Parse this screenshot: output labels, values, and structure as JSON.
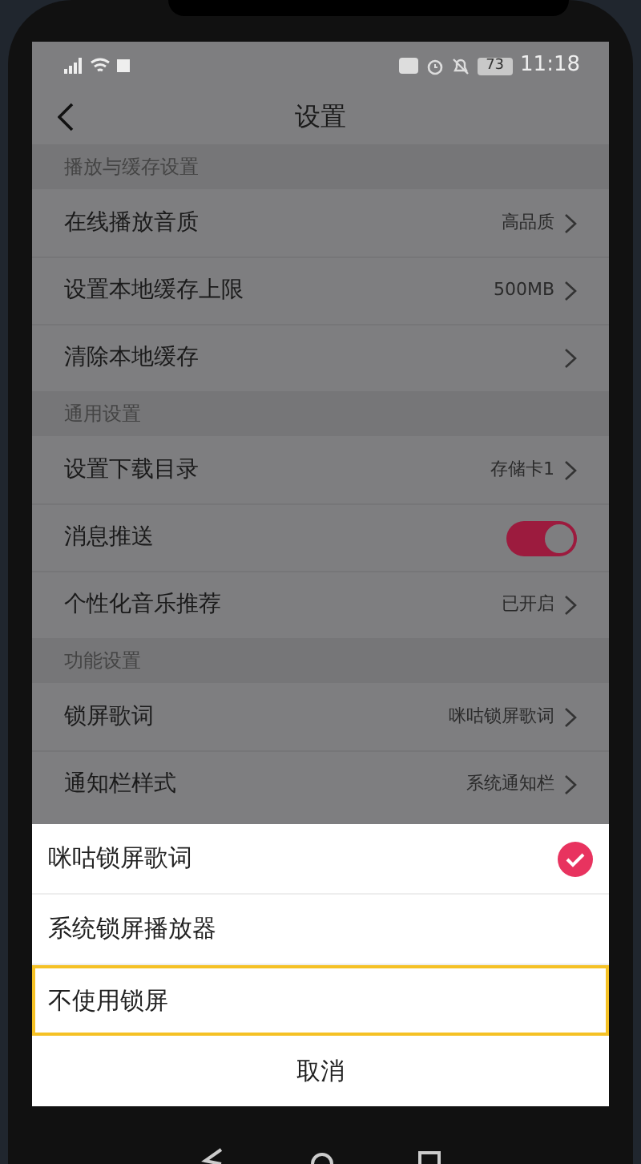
{
  "status_bar": {
    "battery": "73",
    "time": "11:18"
  },
  "title": "设置",
  "sections": [
    {
      "header": "播放与缓存设置",
      "rows": [
        {
          "kind": "link",
          "label": "在线播放音质",
          "value": "高品质"
        },
        {
          "kind": "link",
          "label": "设置本地缓存上限",
          "value": "500MB"
        },
        {
          "kind": "link",
          "label": "清除本地缓存"
        }
      ]
    },
    {
      "header": "通用设置",
      "rows": [
        {
          "kind": "link",
          "label": "设置下载目录",
          "value": "存储卡1"
        },
        {
          "kind": "toggle",
          "label": "消息推送",
          "on": true
        },
        {
          "kind": "link",
          "label": "个性化音乐推荐",
          "value": "已开启"
        }
      ]
    },
    {
      "header": "功能设置",
      "rows": [
        {
          "kind": "link",
          "label": "锁屏歌词",
          "value": "咪咕锁屏歌词"
        },
        {
          "kind": "link",
          "label": "通知栏样式",
          "value": "系统通知栏"
        }
      ]
    }
  ],
  "sheet": {
    "options": [
      {
        "label": "咪咕锁屏歌词",
        "selected": true
      },
      {
        "label": "系统锁屏播放器",
        "selected": false
      },
      {
        "label": "不使用锁屏",
        "selected": false,
        "highlighted": true
      }
    ],
    "cancel": "取消"
  }
}
